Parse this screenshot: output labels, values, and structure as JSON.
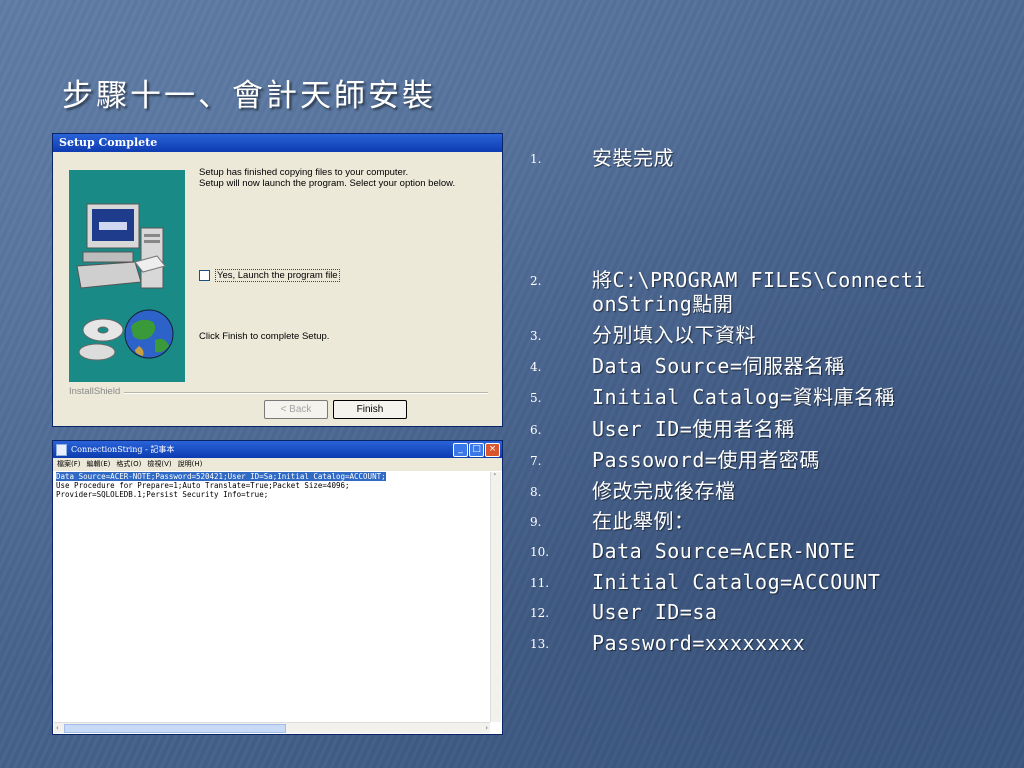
{
  "slide": {
    "title": "步驟十一、會計天師安裝"
  },
  "setup_dialog": {
    "title": "Setup Complete",
    "message_line1": "Setup has finished copying files to your computer.",
    "message_line2": "Setup will now launch the program. Select your option below.",
    "launch_checkbox_label": "Yes, Launch the program file",
    "launch_checked": false,
    "finish_instruction": "Click Finish to complete Setup.",
    "installshield_label": "InstallShield",
    "back_button": "< Back",
    "finish_button": "Finish"
  },
  "notepad": {
    "title": "ConnectionString - 記事本",
    "menu": [
      "檔案(F)",
      "編輯(E)",
      "格式(O)",
      "檢視(V)",
      "說明(H)"
    ],
    "lines": [
      "Data Source=ACER-NOTE;Password=520421;User ID=Sa;Initial Catalog=ACCOUNT;",
      "Use Procedure for Prepare=1;Auto Translate=True;Packet Size=4096;",
      "Provider=SQLOLEDB.1;Persist Security Info=true;"
    ]
  },
  "steps": [
    {
      "num": "1.",
      "text": "安裝完成"
    },
    {
      "num": "2.",
      "text": "將C:\\PROGRAM FILES\\ConnectionString點開"
    },
    {
      "num": "3.",
      "text": "分別填入以下資料"
    },
    {
      "num": "4.",
      "text": "Data Source=伺服器名稱"
    },
    {
      "num": "5.",
      "text": "Initial Catalog=資料庫名稱"
    },
    {
      "num": "6.",
      "text": "User ID=使用者名稱"
    },
    {
      "num": "7.",
      "text": "Passoword=使用者密碼"
    },
    {
      "num": "8.",
      "text": "修改完成後存檔"
    },
    {
      "num": "9.",
      "text": "在此舉例："
    },
    {
      "num": "10.",
      "text": "Data Source=ACER-NOTE"
    },
    {
      "num": "11.",
      "text": "Initial Catalog=ACCOUNT"
    },
    {
      "num": "12.",
      "text": "User ID=sa"
    },
    {
      "num": "13.",
      "text": "Password=xxxxxxxx"
    }
  ],
  "colors": {
    "background": "#4a6690",
    "titlebar": "#0d3bb0",
    "graphic_panel": "#1a8a86"
  }
}
